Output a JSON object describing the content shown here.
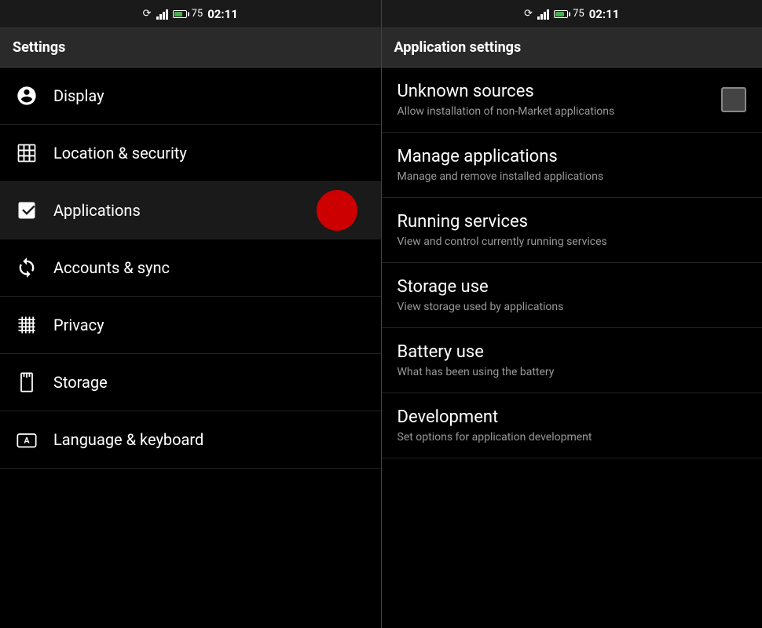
{
  "statusbar": {
    "left": {
      "signal_strength": "75",
      "time": "02:11"
    },
    "right": {
      "signal_strength": "75",
      "time": "02:11"
    }
  },
  "left_panel": {
    "header": "Settings",
    "items": [
      {
        "id": "display",
        "label": "Display",
        "icon": "display-icon"
      },
      {
        "id": "location-security",
        "label": "Location & security",
        "icon": "location-security-icon"
      },
      {
        "id": "applications",
        "label": "Applications",
        "icon": "applications-icon",
        "active": true,
        "has_red_dot": true
      },
      {
        "id": "accounts-sync",
        "label": "Accounts & sync",
        "icon": "accounts-sync-icon"
      },
      {
        "id": "privacy",
        "label": "Privacy",
        "icon": "privacy-icon"
      },
      {
        "id": "storage",
        "label": "Storage",
        "icon": "storage-icon"
      },
      {
        "id": "language-keyboard",
        "label": "Language & keyboard",
        "icon": "language-keyboard-icon"
      }
    ]
  },
  "right_panel": {
    "header": "Application settings",
    "items": [
      {
        "id": "unknown-sources",
        "title": "Unknown sources",
        "description": "Allow installation of non-Market applications",
        "has_checkbox": true,
        "checkbox_checked": false
      },
      {
        "id": "manage-applications",
        "title": "Manage applications",
        "description": "Manage and remove installed applications",
        "has_checkbox": false
      },
      {
        "id": "running-services",
        "title": "Running services",
        "description": "View and control currently running services",
        "has_checkbox": false
      },
      {
        "id": "storage-use",
        "title": "Storage use",
        "description": "View storage used by applications",
        "has_checkbox": false
      },
      {
        "id": "battery-use",
        "title": "Battery use",
        "description": "What has been using the battery",
        "has_checkbox": false
      },
      {
        "id": "development",
        "title": "Development",
        "description": "Set options for application development",
        "has_checkbox": false
      }
    ]
  }
}
